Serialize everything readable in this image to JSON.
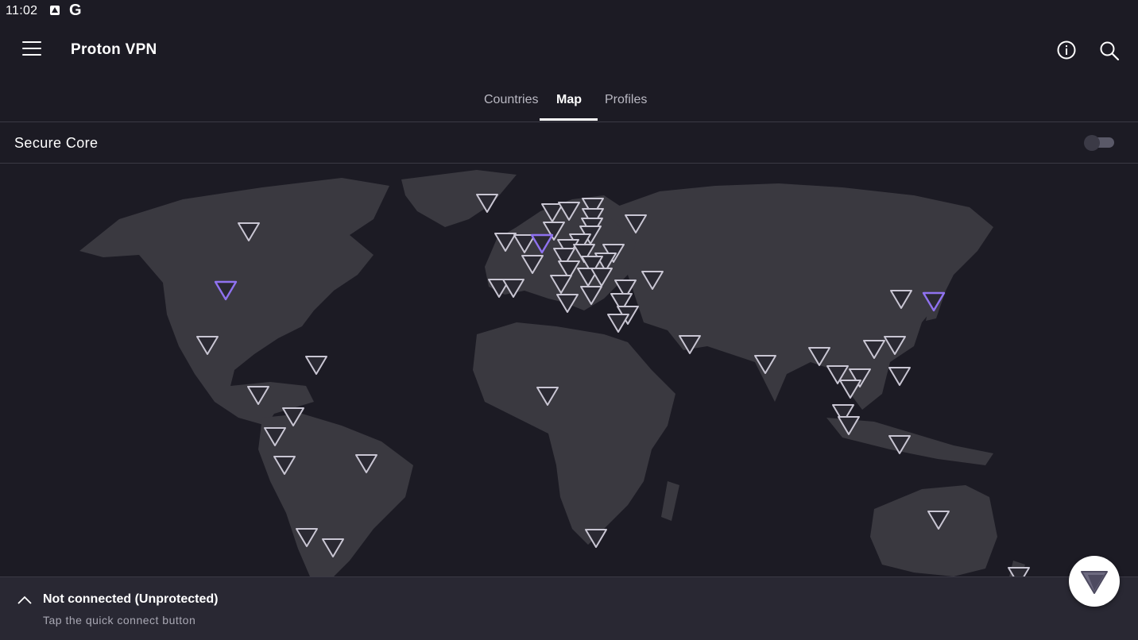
{
  "status_bar": {
    "time": "11:02",
    "icons": [
      "app-store-icon",
      "google-icon"
    ],
    "google_letter": "G"
  },
  "app_bar": {
    "title": "Proton VPN",
    "icons": [
      "menu-icon",
      "info-icon",
      "search-icon"
    ]
  },
  "tabs": [
    {
      "label": "Countries",
      "active": false
    },
    {
      "label": "Map",
      "active": true
    },
    {
      "label": "Profiles",
      "active": false
    }
  ],
  "secure_core": {
    "label": "Secure Core",
    "enabled": false
  },
  "connection": {
    "status": "Not connected (Unprotected)",
    "hint": "Tap the quick connect button"
  },
  "colors": {
    "background": "#1c1b24",
    "land": "#3a3940",
    "marker": "#2a2932",
    "marker_stroke": "#c9c6d3",
    "marker_highlight": "#8f72f0",
    "bottom_bar": "#292833"
  }
}
